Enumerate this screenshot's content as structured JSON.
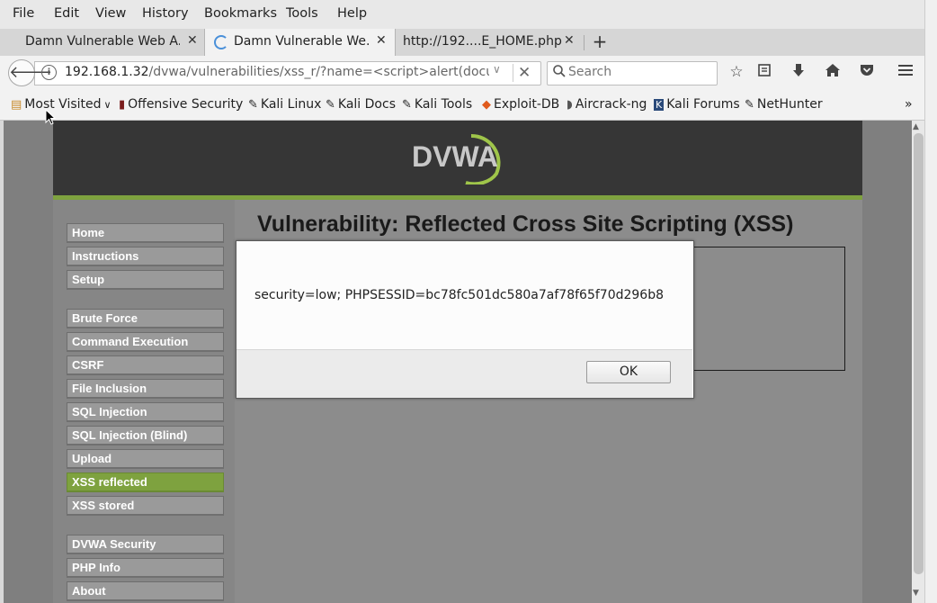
{
  "menubar": {
    "items": [
      {
        "label": "File"
      },
      {
        "label": "Edit"
      },
      {
        "label": "View"
      },
      {
        "label": "History"
      },
      {
        "label": "Bookmarks"
      },
      {
        "label": "Tools"
      },
      {
        "label": "Help"
      }
    ]
  },
  "tabs": [
    {
      "label": "Damn Vulnerable Web A...",
      "active": false
    },
    {
      "label": "Damn Vulnerable We...",
      "active": true
    },
    {
      "label": "http://192....E_HOME.php",
      "active": false
    }
  ],
  "navbar": {
    "url_host": "192.168.1.32",
    "url_path": "/dvwa/vulnerabilities/xss_r/?name=<script>alert(document.c",
    "search_placeholder": "Search"
  },
  "bookmarks": [
    {
      "label": "Most Visited",
      "icon": "folder-icon"
    },
    {
      "label": "Offensive Security",
      "icon": "offsec-icon"
    },
    {
      "label": "Kali Linux",
      "icon": "kali-icon"
    },
    {
      "label": "Kali Docs",
      "icon": "kali-icon"
    },
    {
      "label": "Kali Tools",
      "icon": "kali-icon"
    },
    {
      "label": "Exploit-DB",
      "icon": "exploitdb-icon"
    },
    {
      "label": "Aircrack-ng",
      "icon": "aircrack-icon"
    },
    {
      "label": "Kali Forums",
      "icon": "kali-forums-icon"
    },
    {
      "label": "NetHunter",
      "icon": "kali-icon"
    }
  ],
  "page": {
    "logo_text": "DVWA",
    "title": "Vulnerability: Reflected Cross Site Scripting (XSS)",
    "nav_group1": [
      "Home",
      "Instructions",
      "Setup"
    ],
    "nav_group2": [
      "Brute Force",
      "Command Execution",
      "CSRF",
      "File Inclusion",
      "SQL Injection",
      "SQL Injection (Blind)",
      "Upload",
      "XSS reflected",
      "XSS stored"
    ],
    "nav_group3": [
      "DVWA Security",
      "PHP Info",
      "About"
    ],
    "selected_nav": "XSS reflected",
    "accent_color": "#7ea23f"
  },
  "dialog": {
    "message": "security=low; PHPSESSID=bc78fc501dc580a7af78f65f70d296b8",
    "ok_label": "OK"
  }
}
